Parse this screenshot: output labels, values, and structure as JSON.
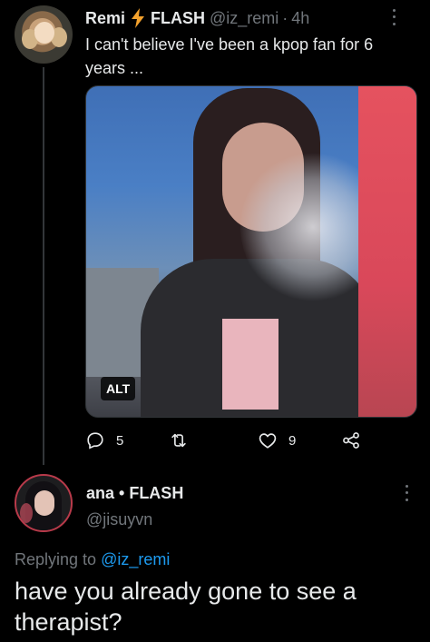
{
  "tweet1": {
    "name": "Remi",
    "name_suffix": "FLASH",
    "handle": "@iz_remi",
    "separator": "·",
    "time": "4h",
    "text": "I can't believe I've been a kpop fan for 6 years ...",
    "media_alt_badge": "ALT",
    "actions": {
      "reply_count": "5",
      "retweet_count": "",
      "like_count": "9"
    }
  },
  "tweet2": {
    "name": "ana • FLASH",
    "handle": "@jisuyvn",
    "replying_prefix": "Replying to ",
    "replying_mention": "@iz_remi",
    "text": "have you already gone to see a therapist?"
  },
  "colors": {
    "background": "#000000",
    "text": "#e7e9ea",
    "muted": "#71767b",
    "link": "#1d9bf0",
    "bolt": "#f4a22d"
  },
  "icons": [
    "bolt-icon",
    "reply-icon",
    "retweet-icon",
    "like-icon",
    "share-icon",
    "more-icon"
  ]
}
